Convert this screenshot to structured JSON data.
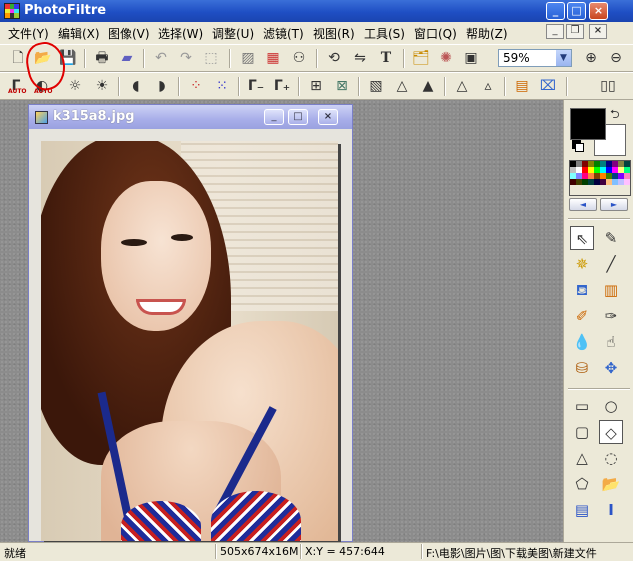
{
  "window": {
    "title": "PhotoFiltre",
    "minimize": "_",
    "maximize": "□",
    "close": "×"
  },
  "menu": [
    "文件(Y)",
    "编辑(X)",
    "图像(V)",
    "选择(W)",
    "调整(U)",
    "滤镜(T)",
    "视图(R)",
    "工具(S)",
    "窗口(Q)",
    "帮助(Z)"
  ],
  "toolbar": {
    "zoom_value": "59%",
    "zoom_arrow": "▼",
    "text_tool_glyph": "T",
    "auto_label": "AUTO"
  },
  "document": {
    "title": "k315a8.jpg",
    "minimize": "_",
    "maximize": "□",
    "close": "×"
  },
  "palette": {
    "colors": [
      "#000000",
      "#808080",
      "#800000",
      "#808000",
      "#008000",
      "#008080",
      "#000080",
      "#800080",
      "#808040",
      "#004040",
      "#c0c0c0",
      "#ffffff",
      "#ff0000",
      "#ffff00",
      "#00ff00",
      "#00ffff",
      "#0000ff",
      "#ff00ff",
      "#ffff80",
      "#00ff80",
      "#80ffff",
      "#8080ff",
      "#ff0080",
      "#ff8040",
      "#804000",
      "#ff8000",
      "#408000",
      "#004080",
      "#8000ff",
      "#ff80c0",
      "#400000",
      "#404000",
      "#004000",
      "#004040",
      "#000040",
      "#400040",
      "#ffc080",
      "#80c0ff",
      "#c0c0ff",
      "#ffc0ff"
    ],
    "foreground": "#000000",
    "background": "#ffffff",
    "prev": "◄",
    "next": "►"
  },
  "status": {
    "ready": "就绪",
    "image_size": "505x674x16M",
    "coords": "X:Y = 457:644",
    "path": "F:\\电影\\图片\\图\\下载美图\\新建文件"
  }
}
